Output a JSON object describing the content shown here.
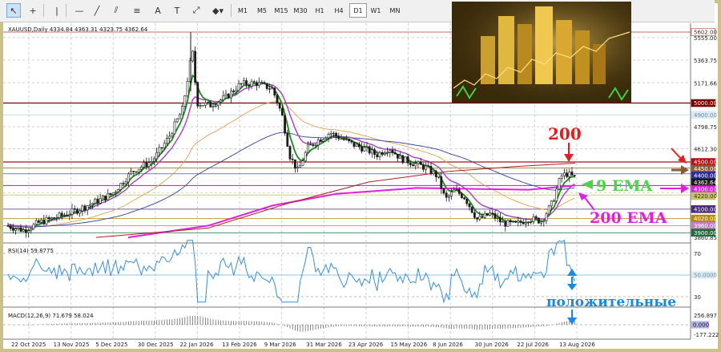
{
  "toolbar": {
    "tools": [
      {
        "name": "cursor-tool-button",
        "glyph": "↖"
      },
      {
        "name": "crosshair-tool-button",
        "glyph": "+"
      },
      {
        "name": "vertical-line-tool-button",
        "glyph": "|"
      },
      {
        "name": "horizontal-line-tool-button",
        "glyph": "—"
      },
      {
        "name": "trendline-tool-button",
        "glyph": "╱"
      },
      {
        "name": "channel-tool-button",
        "glyph": "⫽"
      },
      {
        "name": "fibonacci-tool-button",
        "glyph": "≡"
      },
      {
        "name": "text-tool-button",
        "glyph": "A"
      },
      {
        "name": "text-label-tool-button",
        "glyph": "T"
      },
      {
        "name": "arrow-tool-button",
        "glyph": "⤢"
      },
      {
        "name": "shapes-tool-button",
        "glyph": "◆▾"
      }
    ],
    "timeframes": [
      "M1",
      "M5",
      "M15",
      "M30",
      "H1",
      "H4",
      "D1",
      "W1",
      "MN"
    ],
    "active_timeframe": "D1"
  },
  "chart": {
    "symbol_line": "XAUUSD,Daily  4334.84 4363.31 4323.75 4362.64",
    "rsi_label": "RSI(14) 59.8775",
    "macd_label": "MACD(12,26,9) 71.679 58.024"
  },
  "price_axis": {
    "ticks": [
      "5555.00",
      "5363.75",
      "5171.66",
      "4798.75",
      "4612.30",
      "4240.00",
      "3860.85"
    ],
    "labels": [
      {
        "text": "5602.00",
        "bg": "#ffffff",
        "fg": "#333333",
        "border": "#c0392b"
      },
      {
        "text": "5000.00",
        "bg": "#7a0000",
        "fg": "#ffffff",
        "border": "#7a0000"
      },
      {
        "text": "4900.00",
        "bg": "#dbeaf3",
        "fg": "#6a8fa6",
        "border": "#dbeaf3"
      },
      {
        "text": "4500.00",
        "bg": "#b01010",
        "fg": "#ffffff",
        "border": "#b01010"
      },
      {
        "text": "4450.00",
        "bg": "#8a5a3a",
        "fg": "#ffffff",
        "border": "#8a5a3a"
      },
      {
        "text": "4400.00",
        "bg": "#2a2a9a",
        "fg": "#ffffff",
        "border": "#2a2a9a"
      },
      {
        "text": "4362.64",
        "bg": "#1a1a1a",
        "fg": "#ffffff",
        "border": "#1a1a1a"
      },
      {
        "text": "4300.00",
        "bg": "#e020e0",
        "fg": "#ffffff",
        "border": "#e020e0"
      },
      {
        "text": "4220.00",
        "bg": "#c9c06a",
        "fg": "#333333",
        "border": "#c9c06a"
      },
      {
        "text": "4100.00",
        "bg": "#4a2a7a",
        "fg": "#ffffff",
        "border": "#4a2a7a"
      },
      {
        "text": "4020.00",
        "bg": "#b8860b",
        "fg": "#ffffff",
        "border": "#b8860b"
      },
      {
        "text": "3960.00",
        "bg": "#c080c0",
        "fg": "#ffffff",
        "border": "#c080c0"
      },
      {
        "text": "3900.00",
        "bg": "#1f6b3a",
        "fg": "#ffffff",
        "border": "#1f6b3a"
      }
    ],
    "rsi_ticks": [
      "70",
      "30"
    ],
    "rsi_label": "50.0000",
    "macd_ticks": [
      "256.897",
      "0.000",
      "-177.222"
    ]
  },
  "time_axis": [
    "22 Oct 2025",
    "13 Nov 2025",
    "5 Dec 2025",
    "30 Dec 2025",
    "22 Jan 2026",
    "13 Feb 2026",
    "9 Mar 2026",
    "31 Mar 2026",
    "23 Apr 2026",
    "15 May 2026",
    "8 Jun 2026",
    "30 Jun 2026",
    "22 Jul 2026",
    "13 Aug 2026"
  ],
  "annotations": {
    "ma200": "200",
    "ema9": "9 EMA",
    "ema200": "200 EMA",
    "positive": "положительные"
  },
  "colors": {
    "candle": "#1a1a1a",
    "ema9": "#1a8a1a",
    "purple_ma": "#a040c0",
    "orange_ma": "#e0a050",
    "blue_ma": "#3040a0",
    "ema200": "#e020e0",
    "ma200": "#b02020",
    "rsi_line": "#3a8fd0",
    "annot_red": "#e02020",
    "annot_green": "#50d050",
    "annot_magenta": "#e020e0",
    "annot_blue": "#1a8ae0"
  },
  "chart_data": {
    "type": "candlestick",
    "symbol": "XAUUSD",
    "timeframe": "Daily",
    "last_ohlc": {
      "open": 4334.84,
      "high": 4363.31,
      "low": 4323.75,
      "close": 4362.64
    },
    "ylim": [
      3860.85,
      5602.0
    ],
    "close_path": [
      [
        "22 Oct 2025",
        3960
      ],
      [
        "13 Nov 2025",
        4050
      ],
      [
        "5 Dec 2025",
        4210
      ],
      [
        "30 Dec 2025",
        4550
      ],
      [
        "22 Jan 2026",
        5100
      ],
      [
        "13 Feb 2026",
        5300
      ],
      [
        "9 Mar 2026",
        4600
      ],
      [
        "31 Mar 2026",
        4700
      ],
      [
        "23 Apr 2026",
        4560
      ],
      [
        "15 May 2026",
        4400
      ],
      [
        "8 Jun 2026",
        4150
      ],
      [
        "30 Jun 2026",
        3980
      ],
      [
        "22 Jul 2026",
        4090
      ],
      [
        "13 Aug 2026",
        4362.64
      ]
    ],
    "horizontal_levels": [
      5602,
      5000,
      4900,
      4500,
      4450,
      4400,
      4300,
      4220,
      4100,
      4020,
      3960,
      3900
    ],
    "indicators": [
      {
        "name": "RSI(14)",
        "value": 59.8775,
        "levels": [
          70,
          50,
          30
        ]
      },
      {
        "name": "MACD(12,26,9)",
        "main": 71.679,
        "signal": 58.024,
        "range": [
          -177.222,
          256.897
        ]
      }
    ]
  }
}
